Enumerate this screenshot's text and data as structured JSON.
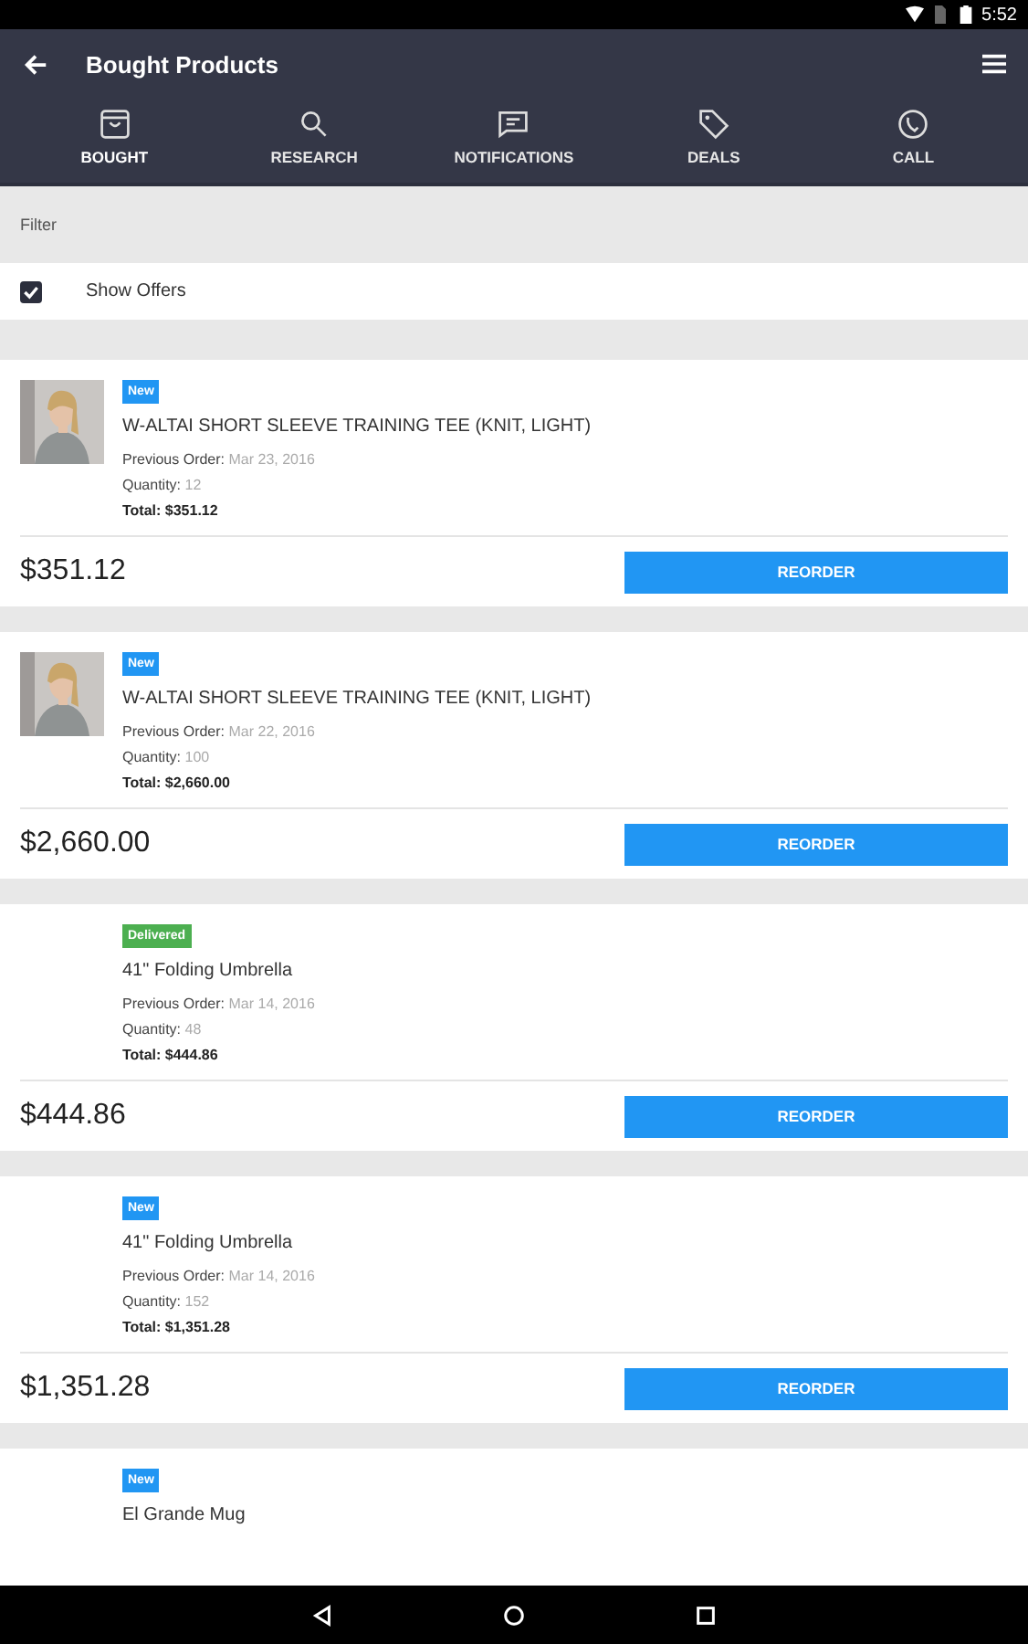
{
  "status_bar": {
    "time": "5:52"
  },
  "toolbar": {
    "title": "Bought Products"
  },
  "tabs": [
    {
      "label": "BOUGHT",
      "kind": "bag",
      "selected": true
    },
    {
      "label": "RESEARCH",
      "kind": "search",
      "selected": false
    },
    {
      "label": "NOTIFICATIONS",
      "kind": "chat",
      "selected": false
    },
    {
      "label": "DEALS",
      "kind": "tag",
      "selected": false
    },
    {
      "label": "CALL",
      "kind": "phone",
      "selected": false
    }
  ],
  "filter": {
    "heading": "Filter",
    "option": {
      "label": "Show Offers",
      "checked": true
    }
  },
  "products": [
    {
      "badge": {
        "label": "New",
        "color": "#2196f3"
      },
      "name": "W-ALTAI SHORT SLEEVE TRAINING TEE (KNIT, LIGHT)",
      "order_label": "Previous Order:",
      "order_date": "Mar 23, 2016",
      "quantity_label": "Quantity:",
      "quantity": "12",
      "total": "Total: $351.12",
      "price": "$351.12",
      "button": "REORDER"
    },
    {
      "badge": {
        "label": "New",
        "color": "#2196f3"
      },
      "name": "W-ALTAI SHORT SLEEVE TRAINING TEE (KNIT, LIGHT)",
      "order_label": "Previous Order:",
      "order_date": "Mar 22, 2016",
      "quantity_label": "Quantity:",
      "quantity": "100",
      "total": "Total: $2,660.00",
      "price": "$2,660.00",
      "button": "REORDER"
    },
    {
      "badge": {
        "label": "Delivered",
        "color": "#4caf50"
      },
      "name": "41\" Folding Umbrella",
      "order_label": "Previous Order:",
      "order_date": "Mar 14, 2016",
      "quantity_label": "Quantity:",
      "quantity": "48",
      "total": "Total: $444.86",
      "price": "$444.86",
      "button": "REORDER"
    },
    {
      "badge": {
        "label": "New",
        "color": "#2196f3"
      },
      "name": "41\" Folding Umbrella",
      "order_label": "Previous Order:",
      "order_date": "Mar 14, 2016",
      "quantity_label": "Quantity:",
      "quantity": "152",
      "total": "Total: $1,351.28",
      "price": "$1,351.28",
      "button": "REORDER"
    },
    {
      "badge": {
        "label": "New",
        "color": "#2196f3"
      },
      "name": "El Grande Mug"
    }
  ]
}
